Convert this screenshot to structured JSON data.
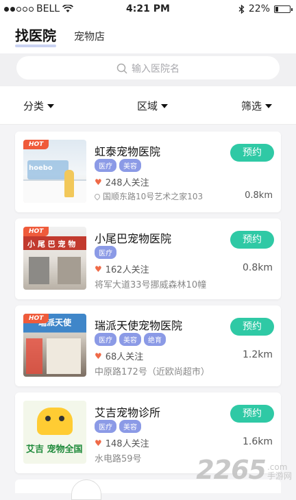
{
  "status_bar": {
    "carrier": "BELL",
    "time": "4:21 PM",
    "battery": "22%",
    "battery_level": 0.22
  },
  "tabs": {
    "active": "找医院",
    "other": "宠物店"
  },
  "search": {
    "placeholder": "输入医院名"
  },
  "filters": {
    "category": "分类",
    "region": "区域",
    "filter": "筛选"
  },
  "hospitals": [
    {
      "badge": "HOT",
      "name": "虹泰宠物医院",
      "tags": [
        "医疗",
        "美容"
      ],
      "followers": "248人关注",
      "address": "国顺东路10号艺术之家103",
      "distance": "0.8km",
      "book_label": "预约",
      "photo_text": "hoebo"
    },
    {
      "badge": "HOT",
      "name": "小尾巴宠物医院",
      "tags": [
        "医疗"
      ],
      "followers": "162人关注",
      "address": "将军大道33号挪威森林10幢",
      "distance": "0.8km",
      "book_label": "预约",
      "photo_text": "小 尾 巴 宠 物"
    },
    {
      "badge": "HOT",
      "name": "瑞派天使宠物医院",
      "tags": [
        "医疗",
        "美容",
        "绝育"
      ],
      "followers": "68人关注",
      "address": "中原路172号（近欧尚超市）",
      "distance": "1.2km",
      "book_label": "预约",
      "photo_text": "瑞派天使"
    },
    {
      "badge": "",
      "name": "艾吉宠物诊所",
      "tags": [
        "医疗",
        "美容"
      ],
      "followers": "148人关注",
      "address": "水电路59号",
      "distance": "1.6km",
      "book_label": "预约",
      "photo_text": "艾吉 宠物全国"
    }
  ],
  "watermark": {
    "number": "2265",
    "suffix": ".com",
    "name": "手游网"
  },
  "colors": {
    "accent": "#2fc9a5",
    "tag": "#8b9ae6",
    "hot": "#ef5b3b",
    "heart": "#ef6a48"
  }
}
